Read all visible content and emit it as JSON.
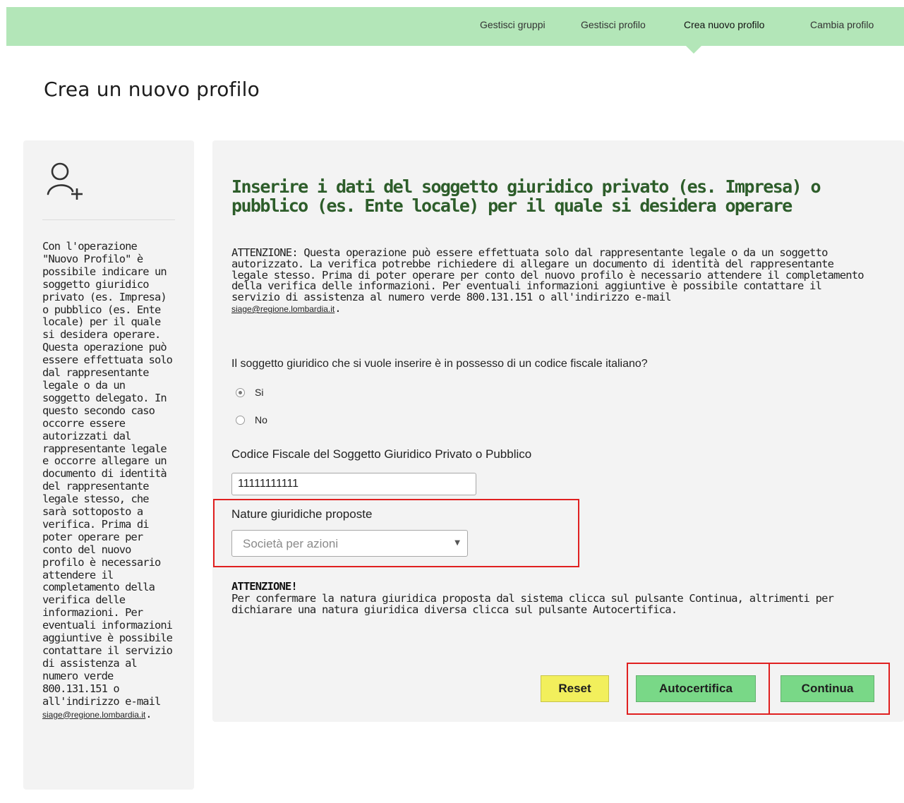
{
  "topnav": {
    "items": [
      {
        "label": "Gestisci gruppi"
      },
      {
        "label": "Gestisci profilo"
      },
      {
        "label": "Crea nuovo profilo",
        "active": true
      },
      {
        "label": "Cambia profilo"
      }
    ]
  },
  "page": {
    "title": "Crea un nuovo profilo"
  },
  "sidebar": {
    "icon": "add-user-icon",
    "text": "Con l'operazione \"Nuovo Profilo\" è possibile indicare un soggetto giuridico privato (es. Impresa) o pubblico (es. Ente locale) per il quale si desidera operare. Questa operazione può essere effettuata solo dal rappresentante legale o da un soggetto delegato. In questo secondo caso occorre essere autorizzati dal rappresentante legale e occorre allegare un documento di identità del rappresentante legale stesso, che sarà sottoposto a verifica. Prima di poter operare per conto del nuovo profilo è necessario attendere il completamento della verifica delle informazioni. Per eventuali informazioni aggiuntive è possibile contattare il servizio di assistenza al numero verde 800.131.151 o all'indirizzo e-mail",
    "email": "siage@regione.lombardia.it",
    "email_suffix": "."
  },
  "form": {
    "heading": "Inserire i dati del soggetto giuridico privato (es. Impresa) o pubblico (es. Ente locale) per il quale si desidera operare",
    "notice": "ATTENZIONE: Questa operazione può essere effettuata solo dal rappresentante legale o da un soggetto autorizzato. La verifica potrebbe richiedere di allegare un documento di identità del rappresentante legale stesso. Prima di poter operare per conto del nuovo profilo è necessario attendere il completamento della verifica delle informazioni. Per eventuali informazioni aggiuntive è possibile contattare il servizio di assistenza al numero verde 800.131.151 o all'indirizzo e-mail",
    "notice_email": "siage@regione.lombardia.it",
    "notice_suffix": ".",
    "question": "Il soggetto giuridico che si vuole inserire è in possesso di un codice fiscale italiano?",
    "radio_yes": "Si",
    "radio_no": "No",
    "radio_selected": "Si",
    "cf_label": "Codice Fiscale del Soggetto Giuridico Privato o Pubblico",
    "cf_value": "11111111111",
    "nature_label": "Nature giuridiche proposte",
    "nature_selected": "Società per azioni",
    "attention_title": "ATTENZIONE!",
    "attention_text": "Per confermare la natura giuridica proposta dal sistema clicca sul pulsante Continua, altrimenti per dichiarare una natura giuridica diversa clicca sul pulsante Autocertifica.",
    "buttons": {
      "reset": "Reset",
      "autocertifica": "Autocertifica",
      "continua": "Continua"
    }
  },
  "colors": {
    "topbar": "#b3e6b8",
    "heading_green": "#2d5d2a",
    "button_green": "#79d887",
    "button_yellow": "#f2ef5c",
    "highlight_red": "#e02020"
  }
}
